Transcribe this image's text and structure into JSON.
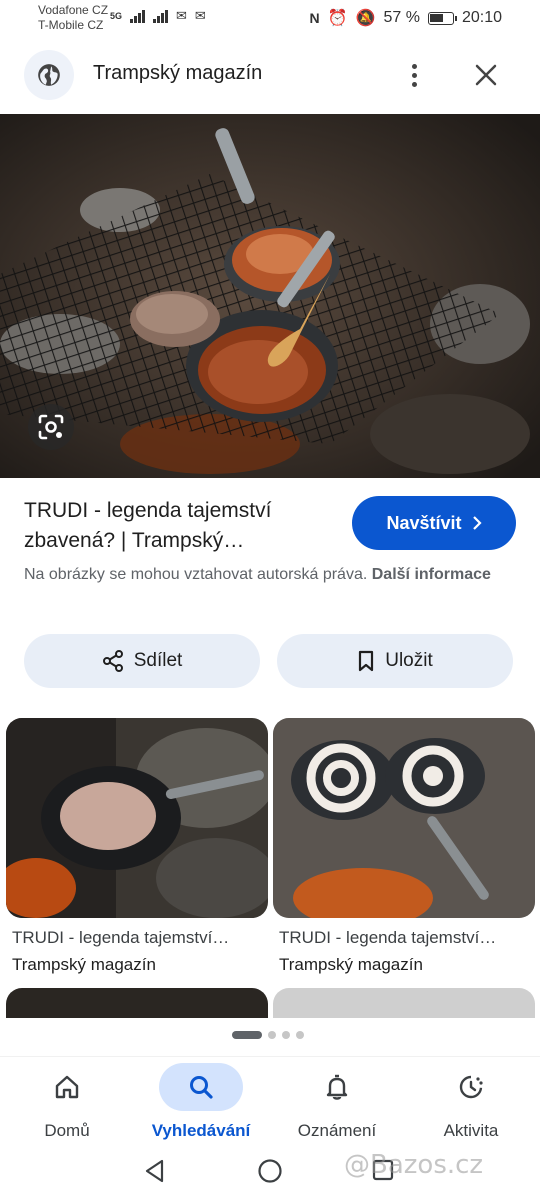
{
  "status_bar": {
    "carrier_1": "Vodafone CZ",
    "carrier_2": "T-Mobile CZ",
    "network": "5G",
    "battery": "57 %",
    "time": "20:10"
  },
  "header": {
    "site_title": "Trampský magazín",
    "globe_icon": "globe-icon",
    "menu_icon": "more-vert-icon",
    "close_icon": "close-icon"
  },
  "result": {
    "title": "TRUDI - legenda tajemství zbavená? | Trampský…",
    "visit_label": "Navštívit",
    "copyright_text": "Na obrázky se mohou vztahovat autorská práva.",
    "more_info": "Další informace",
    "share_label": "Sdílet",
    "save_label": "Uložit"
  },
  "related": [
    {
      "title": "TRUDI - legenda tajemství…",
      "source": "Trampský magazín"
    },
    {
      "title": "TRUDI - legenda tajemství…",
      "source": "Trampský magazín"
    }
  ],
  "pager": {
    "pages": 4,
    "active": 0
  },
  "bottom_nav": [
    {
      "label": "Domů",
      "icon": "home-icon"
    },
    {
      "label": "Vyhledávání",
      "icon": "search-icon",
      "active": true
    },
    {
      "label": "Oznámení",
      "icon": "bell-icon"
    },
    {
      "label": "Aktivita",
      "icon": "activity-icon"
    }
  ],
  "watermark": "@Bazos.cz",
  "colors": {
    "accent": "#0b57d0",
    "chip_bg": "#e8eef7",
    "active_nav_bg": "#d3e3fd"
  }
}
